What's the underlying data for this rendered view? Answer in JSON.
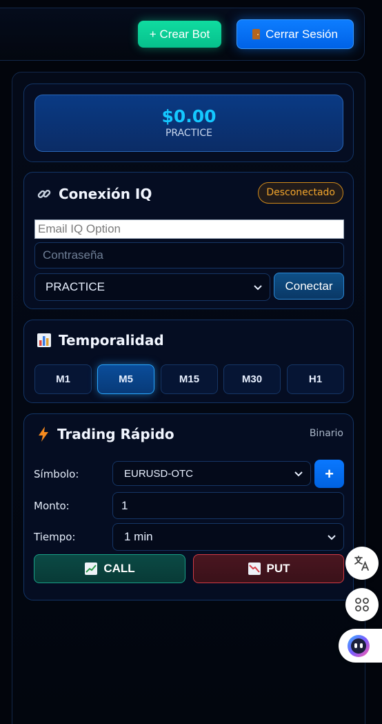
{
  "header": {
    "create_bot_label": "+ Crear Bot",
    "logout_label": "Cerrar Sesión",
    "logout_icon": "door-icon"
  },
  "balance": {
    "amount": "$0.00",
    "mode": "PRACTICE"
  },
  "connection": {
    "title": "Conexión IQ",
    "icon": "link-icon",
    "status": "Desconectado",
    "email_placeholder": "Email IQ Option",
    "password_placeholder": "Contraseña",
    "account_type": "PRACTICE",
    "connect_label": "Conectar"
  },
  "timeframe": {
    "title": "Temporalidad",
    "icon": "bar-chart-icon",
    "options": [
      "M1",
      "M5",
      "M15",
      "M30",
      "H1"
    ],
    "selected": "M5"
  },
  "trading": {
    "title": "Trading Rápido",
    "icon": "lightning-icon",
    "mode": "Binario",
    "symbol_label": "Símbolo:",
    "symbol_value": "EURUSD-OTC",
    "add_label": "+",
    "amount_label": "Monto:",
    "amount_value": "1",
    "time_label": "Tiempo:",
    "time_value": "1 min",
    "call_label": "CALL",
    "put_label": "PUT"
  },
  "colors": {
    "accent_blue": "#0d7dff",
    "accent_green": "#10dca0",
    "balance_text": "#14c8ff",
    "status_orange": "#f2a52c",
    "put_red": "#d23b45"
  }
}
